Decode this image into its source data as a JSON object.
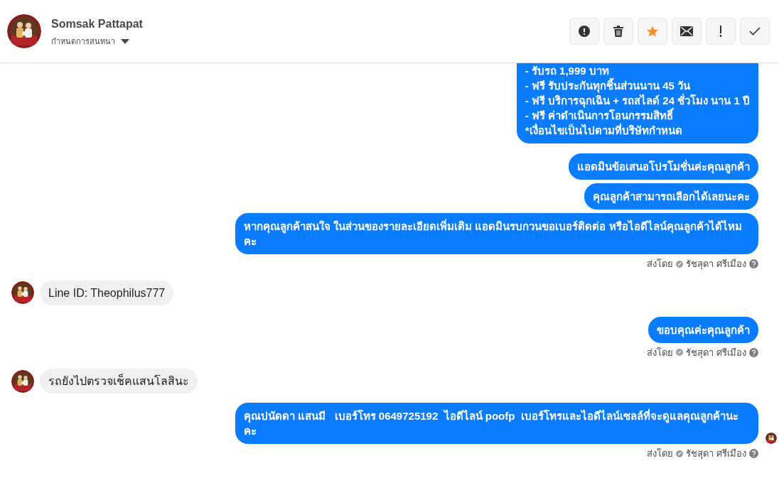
{
  "header": {
    "name": "Somsak Pattapat",
    "subtitle": "กำหนดการสนทนา"
  },
  "actions": [
    {
      "kind": "alert"
    },
    {
      "kind": "trash"
    },
    {
      "kind": "star",
      "on": true
    },
    {
      "kind": "mail"
    },
    {
      "kind": "exclamation"
    },
    {
      "kind": "check"
    }
  ],
  "messages": [
    {
      "kind": "out",
      "lines": [
        "- รับรถ 1,999 บาท",
        "- ฟรี รับประกันทุกชิ้นส่วนนาน 45 วัน",
        "- ฟรี บริการฉุกเฉิน + รถสไลด์ 24 ชั่วโมง นาน 1 ปี",
        "- ฟรี ค่าดำเนินการโอนกรรมสิทธิ์",
        "*เงื่อนไขเป็นไปตามที่บริษัทกำหนด"
      ],
      "cut_top": true
    },
    {
      "kind": "out",
      "lines": [
        "แอดมินข้อเสนอโปรโมชั่นค่ะคุณลูกค้า"
      ]
    },
    {
      "kind": "out",
      "lines": [
        "คุณลูกค้าสามารถเลือกได้เลยนะคะ"
      ]
    },
    {
      "kind": "out",
      "lines": [
        "หากคุณลูกค้าสนใจ ในส่วนของรายละเอียดเพิ่มเติม แอดมินรบกวนขอเบอร์ติดต่อ หรือไอดีไลน์คุณลูกค้าได้ไหมคะ"
      ],
      "sent_by": {
        "label": "ส่งโดย",
        "name": "รัชสุดา ศรีเมือง"
      }
    },
    {
      "kind": "in",
      "lines": [
        "Line ID: Theophilus777"
      ]
    },
    {
      "kind": "out",
      "lines": [
        "ขอบคุณค่ะคุณลูกค้า"
      ],
      "sent_by": {
        "label": "ส่งโดย",
        "name": "รัชสุดา ศรีเมือง"
      }
    },
    {
      "kind": "in",
      "lines": [
        "รถยังไปตรวจเช็คแสนโลสินะ"
      ]
    },
    {
      "kind": "out",
      "lines": [
        "คุณปนัดดา แสนมี   เบอร์โทร 0649725192  ไอดีไลน์ poofp  เบอร์โทรและไอดีไลน์เซลล์ที่จะดูแลคุณลูกค้านะคะ"
      ],
      "seen": true,
      "sent_by": {
        "label": "ส่งโดย",
        "name": "รัชสุดา ศรีเมือง"
      }
    }
  ]
}
